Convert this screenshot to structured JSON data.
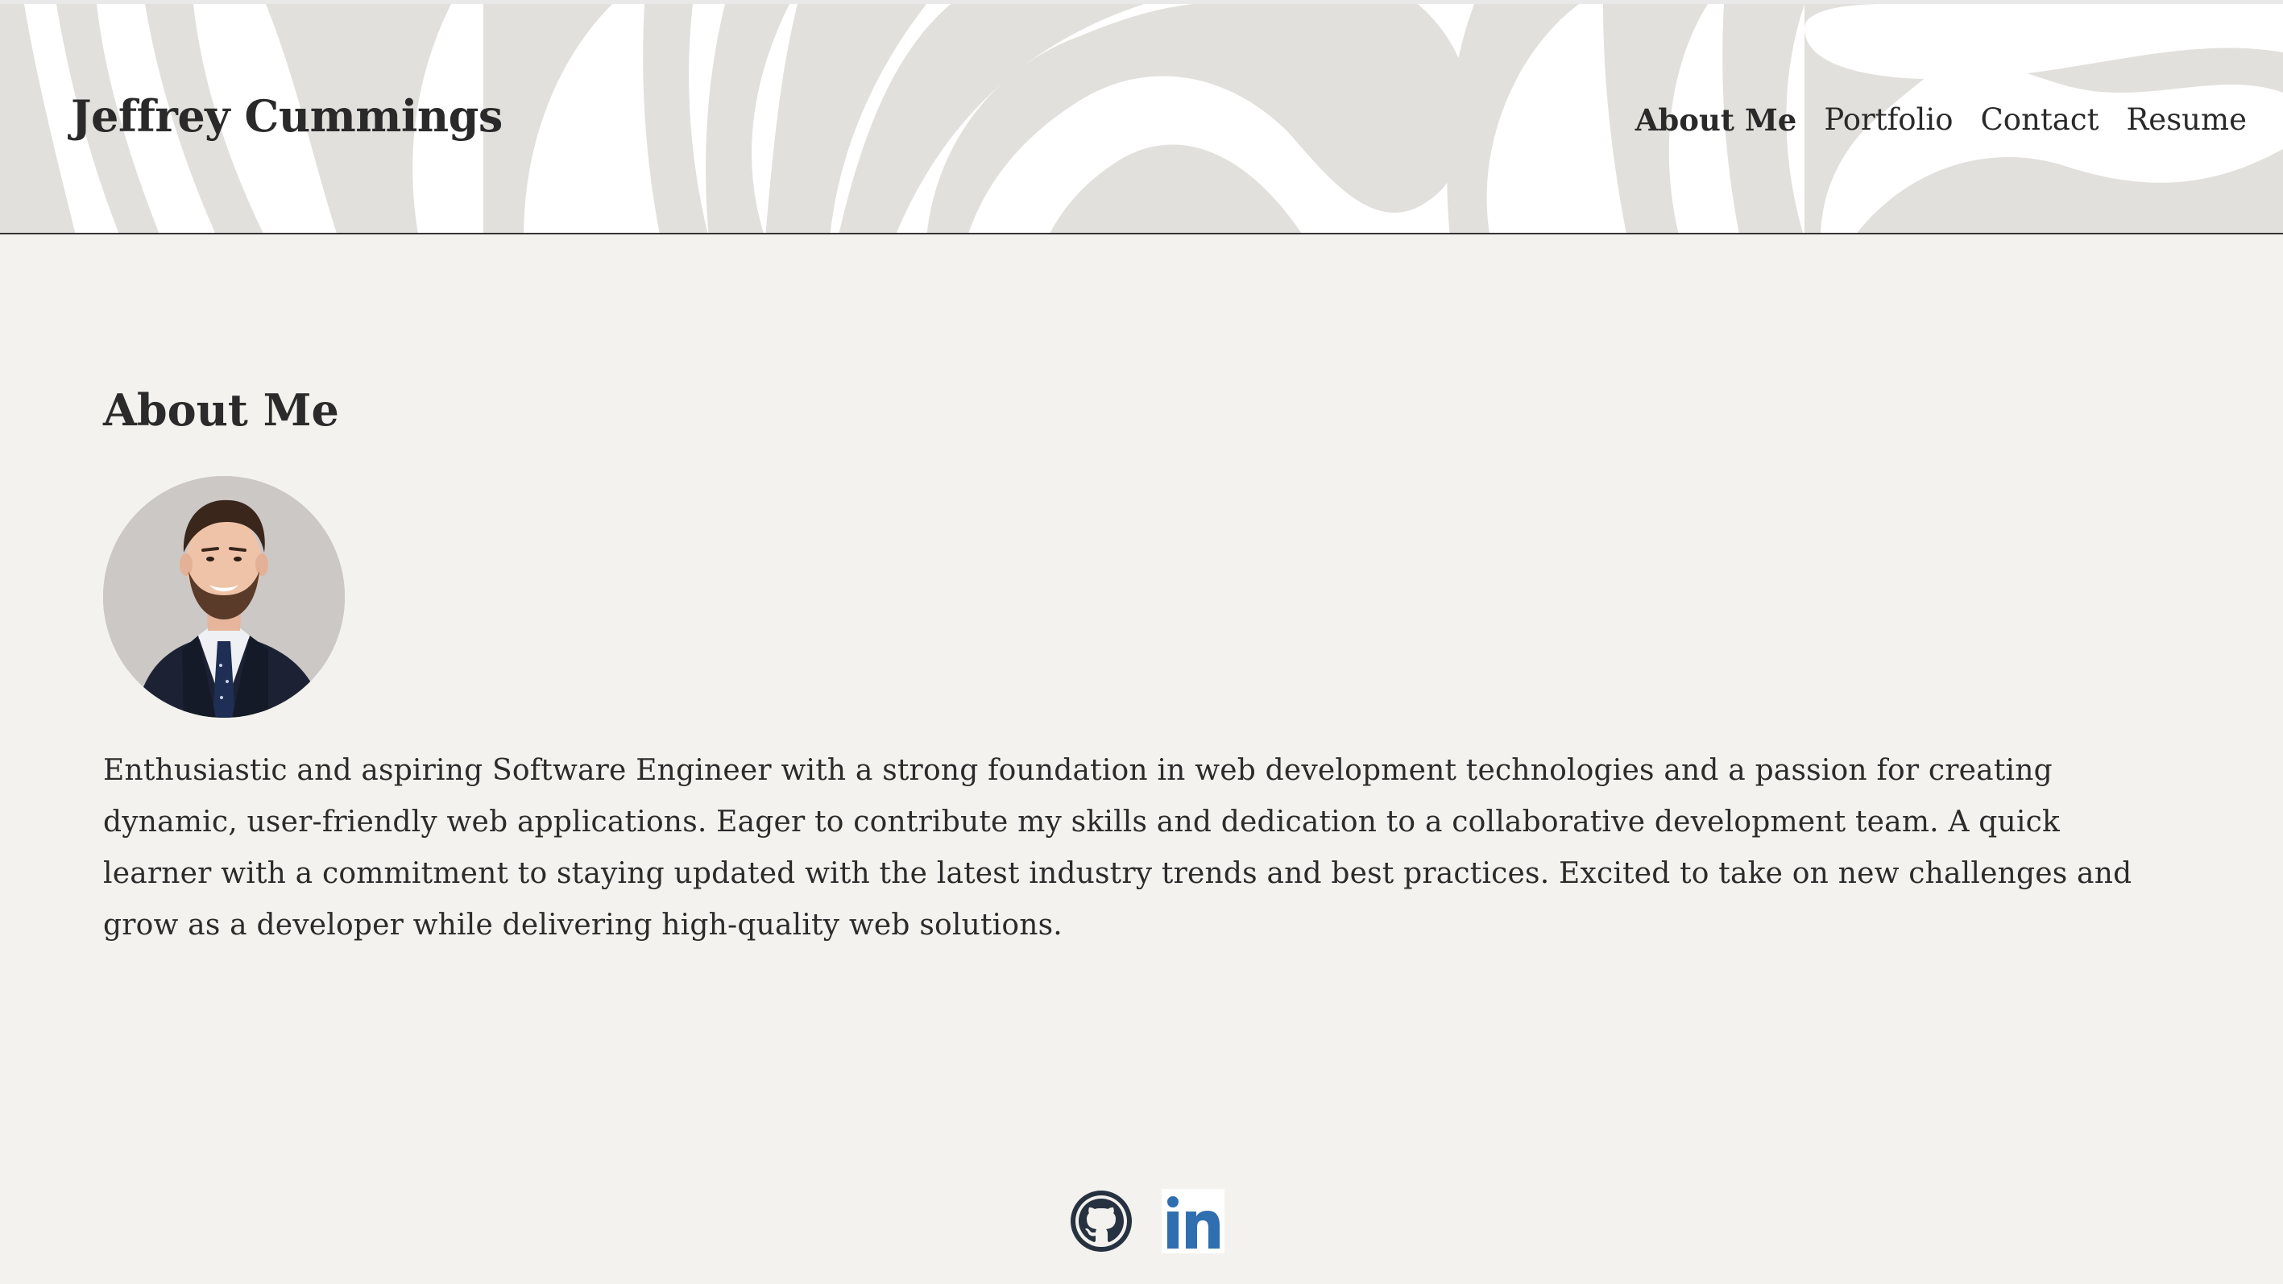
{
  "header": {
    "site_title": "Jeffrey Cummings",
    "nav": [
      {
        "label": "About Me",
        "active": true
      },
      {
        "label": "Portfolio",
        "active": false
      },
      {
        "label": "Contact",
        "active": false
      },
      {
        "label": "Resume",
        "active": false
      }
    ]
  },
  "main": {
    "section_title": "About Me",
    "avatar_icon": "profile-photo",
    "bio": "Enthusiastic and aspiring Software Engineer with a strong foundation in web development technologies and a passion for creating dynamic, user-friendly web applications. Eager to contribute my skills and dedication to a collaborative development team. A quick learner with a commitment to staying updated with the latest industry trends and best practices. Excited to take on new challenges and grow as a developer while delivering high-quality web solutions."
  },
  "footer": {
    "links": [
      {
        "icon": "github-icon"
      },
      {
        "icon": "linkedin-icon"
      }
    ]
  },
  "colors": {
    "background": "#f3f2ef",
    "header_pattern": "#e2e0dc",
    "text": "#2b2b2b",
    "linkedin_blue": "#2f6fb0",
    "github_dark": "#273240"
  }
}
